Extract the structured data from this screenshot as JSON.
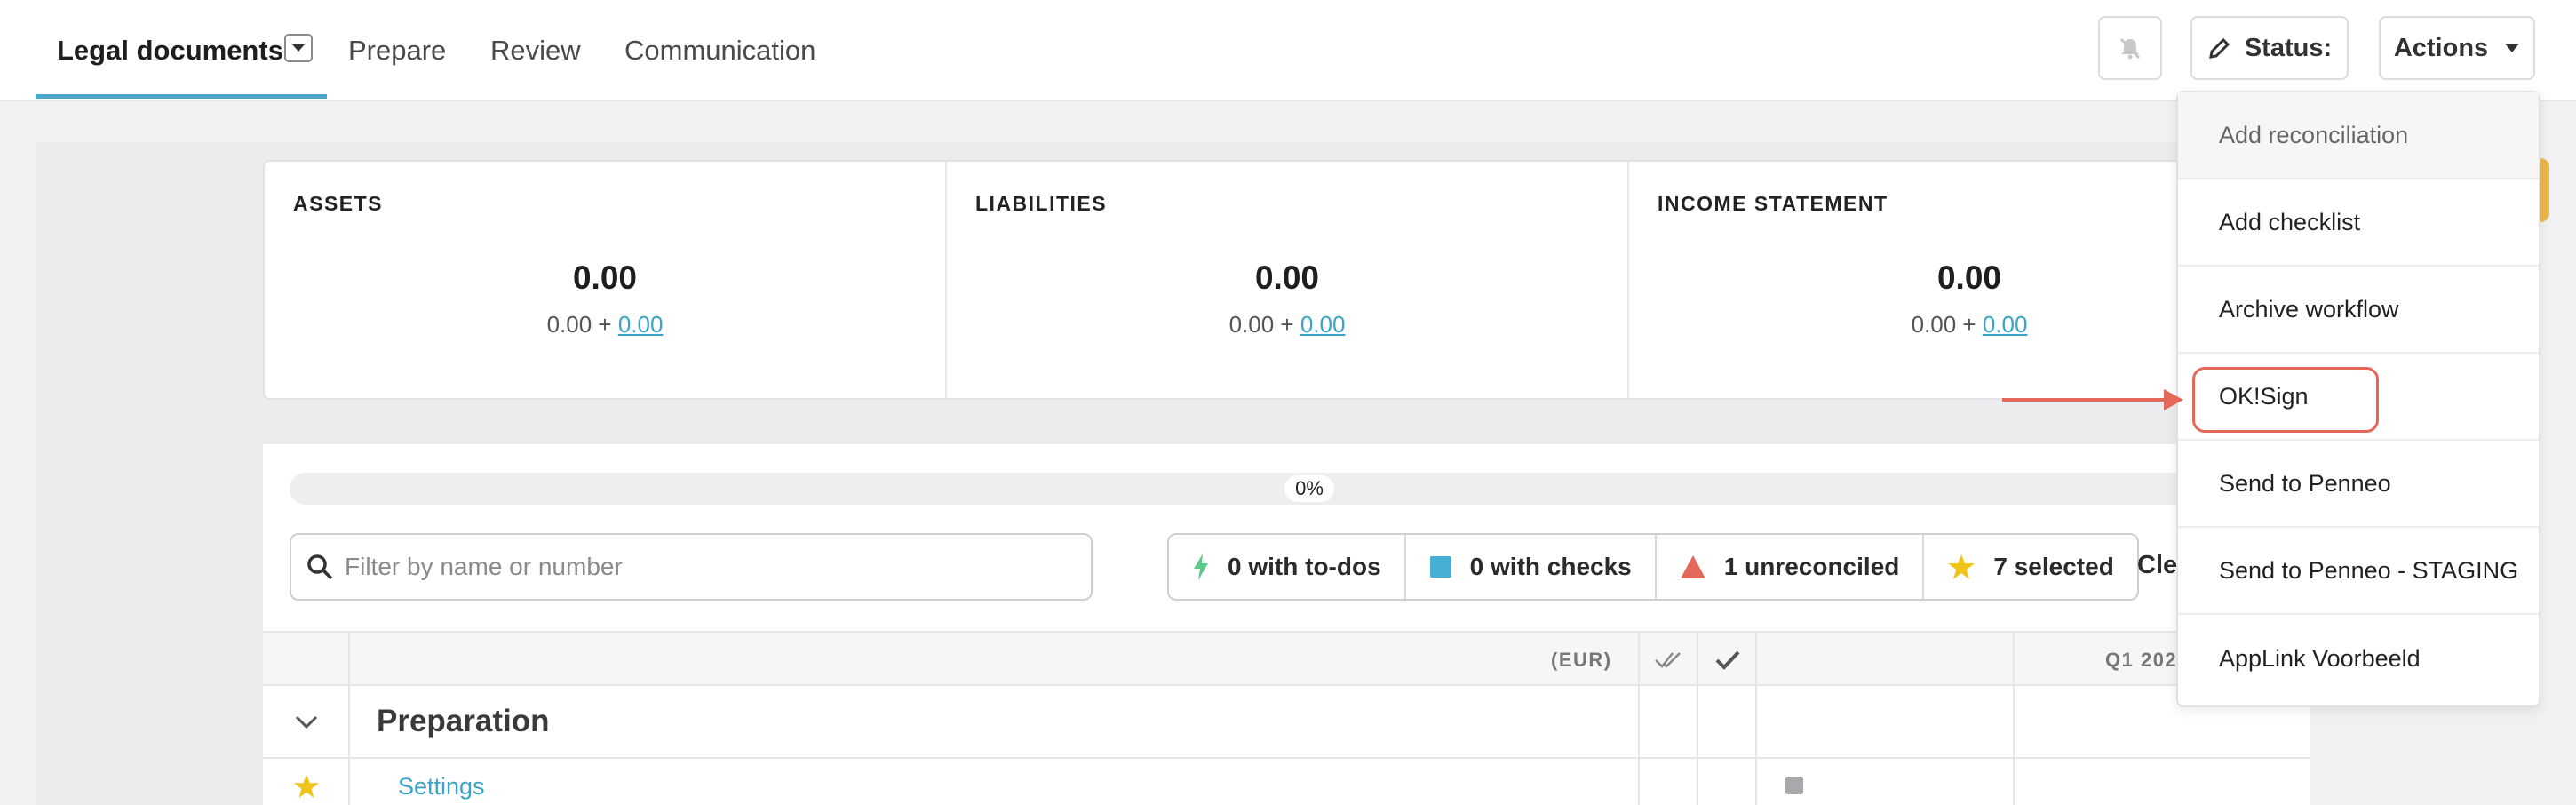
{
  "nav": {
    "tabs": [
      {
        "label": "Legal documents"
      },
      {
        "label": "Prepare"
      },
      {
        "label": "Review"
      },
      {
        "label": "Communication"
      }
    ],
    "status_label": "Status:",
    "actions_label": "Actions"
  },
  "summary": {
    "assets": {
      "title": "ASSETS",
      "value": "0.00",
      "sub_base": "0.00 +",
      "sub_link": "0.00"
    },
    "liabilities": {
      "title": "LIABILITIES",
      "value": "0.00",
      "sub_base": "0.00 +",
      "sub_link": "0.00"
    },
    "income": {
      "title": "INCOME STATEMENT",
      "value": "0.00",
      "sub_base": "0.00 +",
      "sub_link": "0.00"
    }
  },
  "progress": {
    "label": "0%",
    "fraction": 0
  },
  "search": {
    "placeholder": "Filter by name or number"
  },
  "filters": [
    {
      "label": "0 with to-dos",
      "icon": "bolt-icon",
      "color": "#5cc98a"
    },
    {
      "label": "0 with checks",
      "icon": "square-icon",
      "color": "#45b0d3"
    },
    {
      "label": "1 unreconciled",
      "icon": "triangle-icon",
      "color": "#e4685a"
    },
    {
      "label": "7 selected",
      "icon": "star-icon",
      "color": "#f0c419"
    }
  ],
  "clear_label": "Cle",
  "table": {
    "currency_header": "(EUR)",
    "period_header": "Q1 202",
    "group_title": "Preparation",
    "row_link": "Settings"
  },
  "actions_menu": [
    {
      "label": "Add reconciliation"
    },
    {
      "label": "Add checklist"
    },
    {
      "label": "Archive workflow"
    },
    {
      "label": "OK!Sign"
    },
    {
      "label": "Send to Penneo"
    },
    {
      "label": "Send to Penneo - STAGING"
    },
    {
      "label": "AppLink Voorbeeld"
    }
  ],
  "colors": {
    "accent": "#4aa7c9",
    "link": "#3aa3c8",
    "highlight": "#e4685a"
  }
}
